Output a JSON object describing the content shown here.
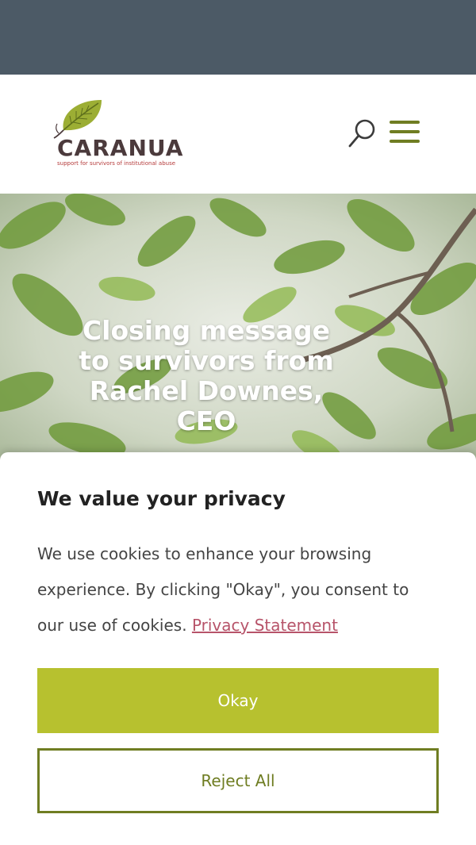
{
  "brand": {
    "name": "CARANUA",
    "tagline": "support for survivors of institutional abuse"
  },
  "header": {
    "search_icon": "search-icon",
    "menu_icon": "hamburger-menu-icon"
  },
  "hero": {
    "title": "Closing message to survivors from Rachel Downes, CEO"
  },
  "cookie_banner": {
    "title": "We value your privacy",
    "text": "We use cookies to enhance your browsing experience. By clicking \"Okay\", you consent to our use of cookies.",
    "link_label": "Privacy Statement",
    "okay_label": "Okay",
    "reject_label": "Reject All"
  },
  "colors": {
    "top_bar": "#4c5a66",
    "accent_green": "#b7c12f",
    "dark_green": "#6f7d22",
    "link": "#b7546a"
  }
}
